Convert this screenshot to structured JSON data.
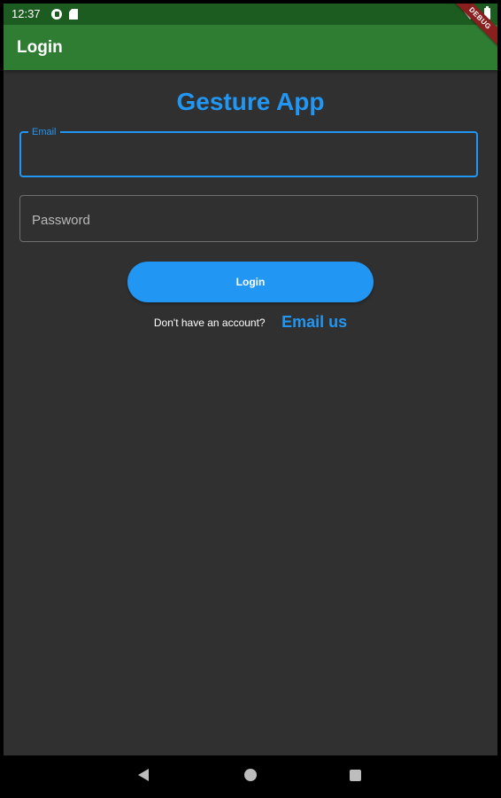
{
  "status_bar": {
    "time": "12:37"
  },
  "app_bar": {
    "title": "Login",
    "debug_banner": "DEBUG"
  },
  "page": {
    "heading": "Gesture App"
  },
  "form": {
    "email_label": "Email",
    "email_value": "",
    "password_placeholder": "Password",
    "password_value": "",
    "login_label": "Login"
  },
  "signup": {
    "prompt": "Don't have an account?",
    "link": "Email us"
  },
  "colors": {
    "accent": "#2196f3",
    "app_bar": "#2e7d32",
    "status_bar": "#1d5c21",
    "background": "#303030"
  },
  "icons": {
    "status_left": [
      "app-notification-icon",
      "sd-card-icon"
    ],
    "status_right": [
      "wifi-icon",
      "battery-icon"
    ],
    "nav": [
      "back-icon",
      "home-icon",
      "recents-icon"
    ]
  }
}
